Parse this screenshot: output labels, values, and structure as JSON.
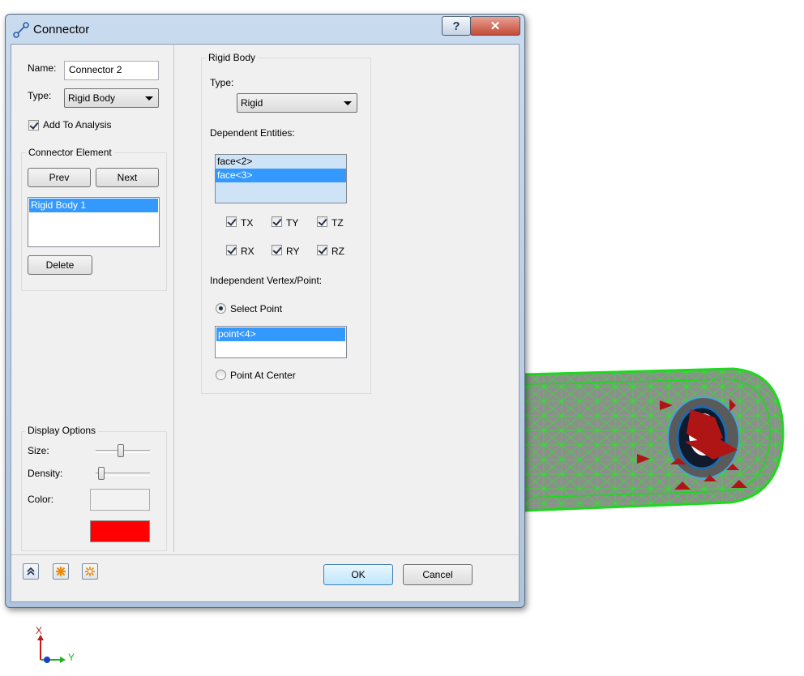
{
  "window": {
    "title": "Connector",
    "help_label": "?",
    "close_label": "✕"
  },
  "left": {
    "name_label": "Name:",
    "name_value": "Connector 2",
    "type_label": "Type:",
    "type_value": "Rigid Body",
    "add_to_analysis": "Add To Analysis",
    "connector_element_title": "Connector Element",
    "prev_label": "Prev",
    "next_label": "Next",
    "elements": [
      "Rigid Body 1"
    ],
    "delete_label": "Delete",
    "display_options_title": "Display Options",
    "size_label": "Size:",
    "size_level": 0.45,
    "density_label": "Density:",
    "density_level": 0.05,
    "color_label": "Color:",
    "color_value": "#ff0000"
  },
  "rigid": {
    "group_title": "Rigid Body",
    "type_label": "Type:",
    "type_value": "Rigid",
    "dependent_label": "Dependent Entities:",
    "dependent_items": [
      "face<2>",
      "face<3>"
    ],
    "dofs": [
      "TX",
      "TY",
      "TZ",
      "RX",
      "RY",
      "RZ"
    ],
    "independent_label": "Independent Vertex/Point:",
    "select_point_label": "Select Point",
    "point_items": [
      "point<4>"
    ],
    "point_at_center_label": "Point At Center"
  },
  "footer": {
    "ok_label": "OK",
    "cancel_label": "Cancel"
  },
  "triad": {
    "x_label": "X",
    "y_label": "Y"
  },
  "icons": [
    "connector-icon",
    "collapse-icon",
    "orange-star-icon",
    "orange-star-icon-2"
  ]
}
